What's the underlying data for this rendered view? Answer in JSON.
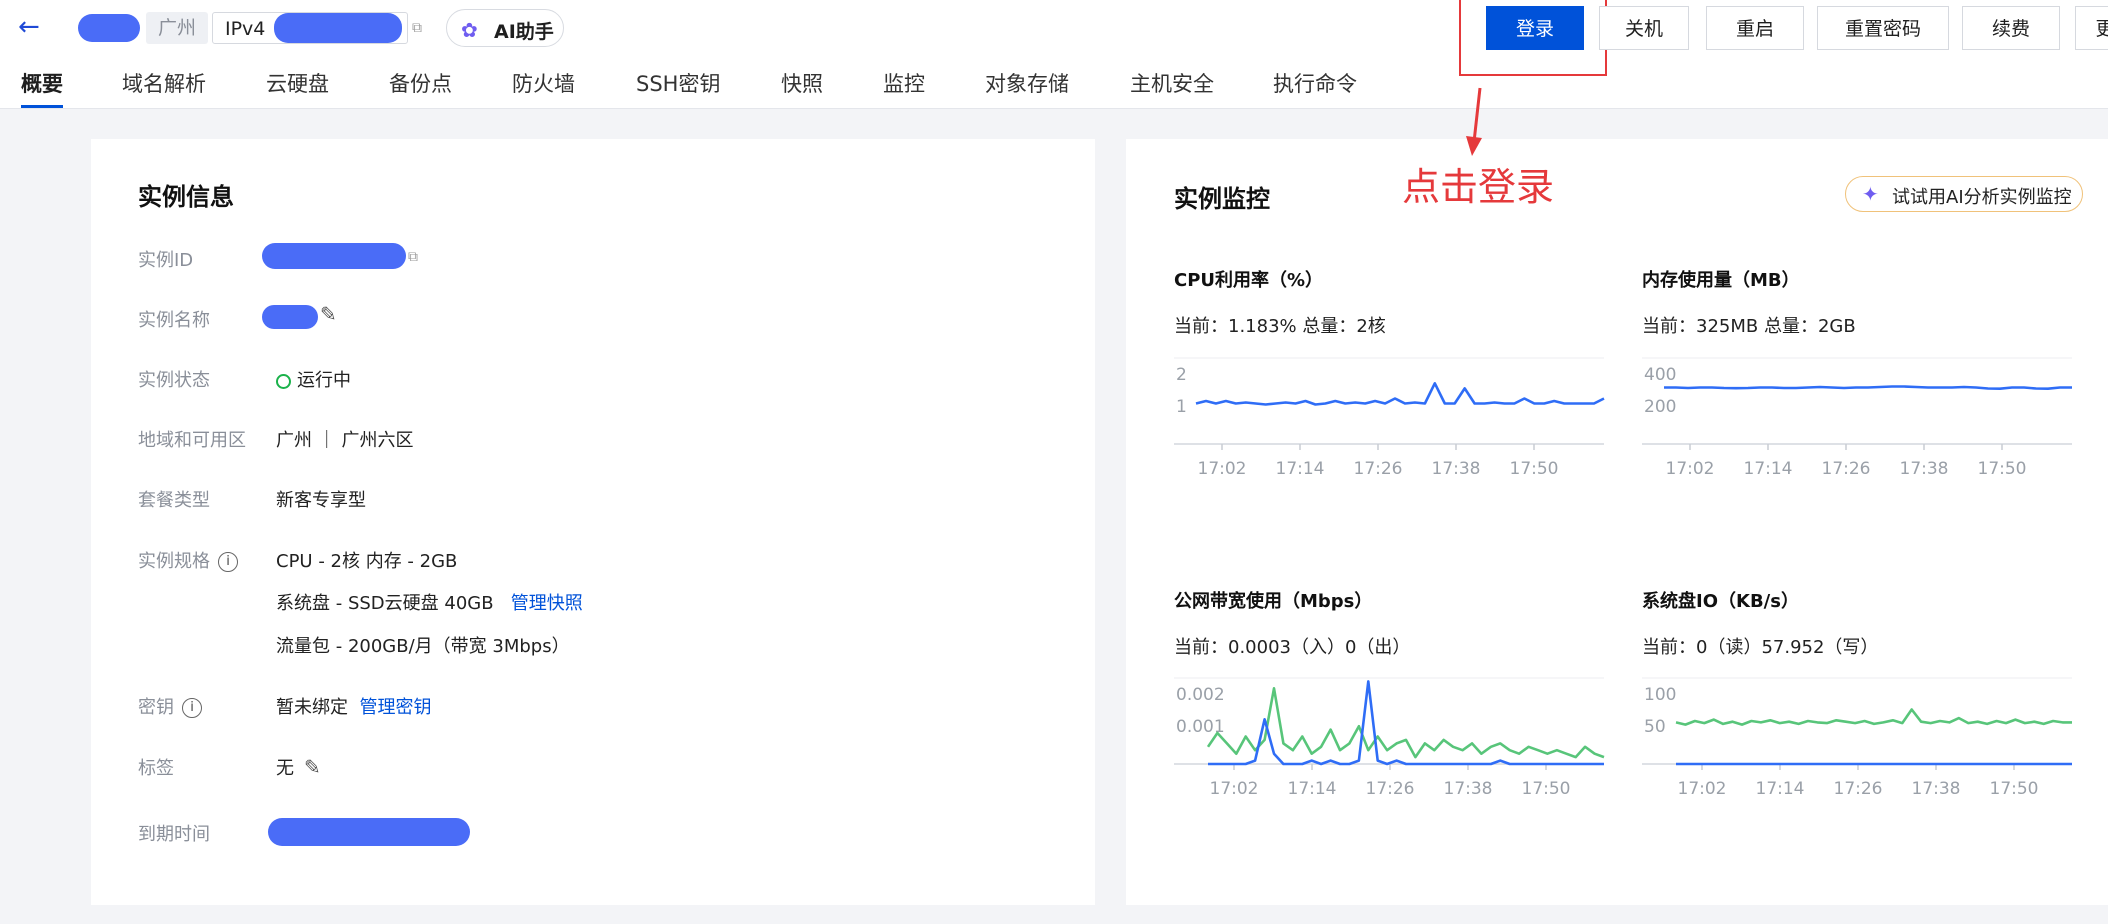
{
  "header": {
    "back_icon": "arrow-left-icon",
    "region_tag": "广州",
    "ip_tag": "IPv4",
    "ai_assistant": "AI助手",
    "actions": [
      "登录",
      "关机",
      "重启",
      "重置密码",
      "续费",
      "更"
    ]
  },
  "tabs": [
    "概要",
    "域名解析",
    "云硬盘",
    "备份点",
    "防火墙",
    "SSH密钥",
    "快照",
    "监控",
    "对象存储",
    "主机安全",
    "执行命令"
  ],
  "instance_info": {
    "title": "实例信息",
    "labels": {
      "id": "实例ID",
      "name": "实例名称",
      "status": "实例状态",
      "region": "地域和可用区",
      "package": "套餐类型",
      "spec": "实例规格",
      "key": "密钥",
      "tag": "标签",
      "expire": "到期时间"
    },
    "status": "运行中",
    "region": "广州 ｜ 广州六区",
    "package": "新客专享型",
    "spec_cpu": "CPU - 2核 内存 - 2GB",
    "spec_disk": "系统盘 - SSD云硬盘 40GB",
    "spec_disk_link": "管理快照",
    "spec_traffic": "流量包 - 200GB/月（带宽 3Mbps）",
    "key_value": "暂未绑定",
    "key_link": "管理密钥",
    "tag_value": "无"
  },
  "annotation": "点击登录",
  "monitor": {
    "title": "实例监控",
    "ai_button": "试试用AI分析实例监控",
    "charts": [
      {
        "title": "CPU利用率（%）",
        "current": "当前：1.183% 总量：2核"
      },
      {
        "title": "内存使用量（MB）",
        "current": "当前：325MB 总量：2GB"
      },
      {
        "title": "公网带宽使用（Mbps）",
        "current": "当前：0.0003（入）0（出）"
      },
      {
        "title": "系统盘IO（KB/s）",
        "current": "当前：0（读）57.952（写）"
      }
    ]
  },
  "chart_data": [
    {
      "type": "line",
      "title": "CPU利用率（%）",
      "x": [
        "17:02",
        "17:14",
        "17:26",
        "17:38",
        "17:50"
      ],
      "ylim": [
        0.5,
        2.2
      ],
      "yticks": [
        "2",
        "1"
      ],
      "series": [
        {
          "color": "#2f6df6",
          "values": [
            1.3,
            1.35,
            1.3,
            1.35,
            1.3,
            1.32,
            1.3,
            1.28,
            1.3,
            1.32,
            1.3,
            1.35,
            1.28,
            1.3,
            1.35,
            1.3,
            1.32,
            1.3,
            1.35,
            1.3,
            1.4,
            1.3,
            1.32,
            1.3,
            1.7,
            1.3,
            1.3,
            1.6,
            1.3,
            1.3,
            1.32,
            1.3,
            1.3,
            1.4,
            1.3,
            1.3,
            1.35,
            1.3,
            1.3,
            1.3,
            1.3,
            1.4
          ]
        }
      ]
    },
    {
      "type": "line",
      "title": "内存使用量（MB）",
      "x": [
        "17:02",
        "17:14",
        "17:26",
        "17:38",
        "17:50"
      ],
      "ylim": [
        100,
        450
      ],
      "yticks": [
        "400",
        "200"
      ],
      "series": [
        {
          "color": "#2f6df6",
          "values": [
            330,
            330,
            328,
            330,
            330,
            328,
            327,
            328,
            330,
            330,
            328,
            328,
            330,
            332,
            330,
            328,
            330,
            330,
            332,
            334,
            334,
            332,
            330,
            330,
            330,
            332,
            330,
            326,
            325,
            330,
            330,
            326,
            325,
            330,
            330
          ]
        }
      ]
    },
    {
      "type": "line",
      "title": "公网带宽使用（Mbps）",
      "x": [
        "17:02",
        "17:14",
        "17:26",
        "17:38",
        "17:50"
      ],
      "ylim": [
        0,
        0.0025
      ],
      "yticks": [
        "0.002",
        "0.001"
      ],
      "series": [
        {
          "color": "#58c57a",
          "values": [
            0.0005,
            0.0009,
            0.0006,
            0.0003,
            0.0008,
            0.0004,
            0.0007,
            0.0022,
            0.0006,
            0.0004,
            0.0008,
            0.0003,
            0.0005,
            0.001,
            0.0004,
            0.0006,
            0.0011,
            0.0004,
            0.0008,
            0.0004,
            0.0006,
            0.0007,
            0.0002,
            0.0006,
            0.0004,
            0.0007,
            0.0005,
            0.0004,
            0.0006,
            0.0003,
            0.0005,
            0.0006,
            0.0004,
            0.0003,
            0.0005,
            0.0004,
            0.0003,
            0.0004,
            0.0003,
            0.0002,
            0.0005,
            0.0003,
            0.0002
          ]
        },
        {
          "color": "#2f6df6",
          "values": [
            0,
            0,
            0,
            0,
            0,
            0.0001,
            0.0013,
            0.0003,
            0,
            0,
            0,
            0.0001,
            0,
            0.0001,
            0,
            0,
            0.0001,
            0.0024,
            0.0001,
            0,
            0.0001,
            0,
            0,
            0,
            0,
            0,
            0,
            0,
            0,
            0,
            0,
            0.0001,
            0,
            0,
            0,
            0,
            0,
            0,
            0,
            0,
            0,
            0,
            0
          ]
        }
      ]
    },
    {
      "type": "line",
      "title": "系统盘IO（KB/s）",
      "x": [
        "17:02",
        "17:14",
        "17:26",
        "17:38",
        "17:50"
      ],
      "ylim": [
        0,
        120
      ],
      "yticks": [
        "100",
        "50"
      ],
      "series": [
        {
          "color": "#58c57a",
          "values": [
            58,
            55,
            60,
            57,
            62,
            56,
            59,
            55,
            60,
            58,
            61,
            57,
            59,
            56,
            60,
            58,
            57,
            61,
            59,
            57,
            60,
            56,
            58,
            61,
            57,
            76,
            59,
            57,
            60,
            58,
            64,
            57,
            59,
            56,
            60,
            57,
            62,
            57,
            59,
            56,
            60,
            58,
            58
          ]
        },
        {
          "color": "#2f6df6",
          "values": [
            0,
            0,
            0,
            0,
            0,
            0,
            0,
            0,
            0,
            0,
            0,
            0,
            0,
            0,
            0,
            0,
            0,
            0,
            0,
            0,
            0,
            0,
            0,
            0,
            0,
            0,
            0,
            0,
            0,
            0,
            0,
            0,
            0,
            0,
            0,
            0,
            0,
            0,
            0,
            0,
            0,
            0,
            0
          ]
        }
      ]
    }
  ]
}
